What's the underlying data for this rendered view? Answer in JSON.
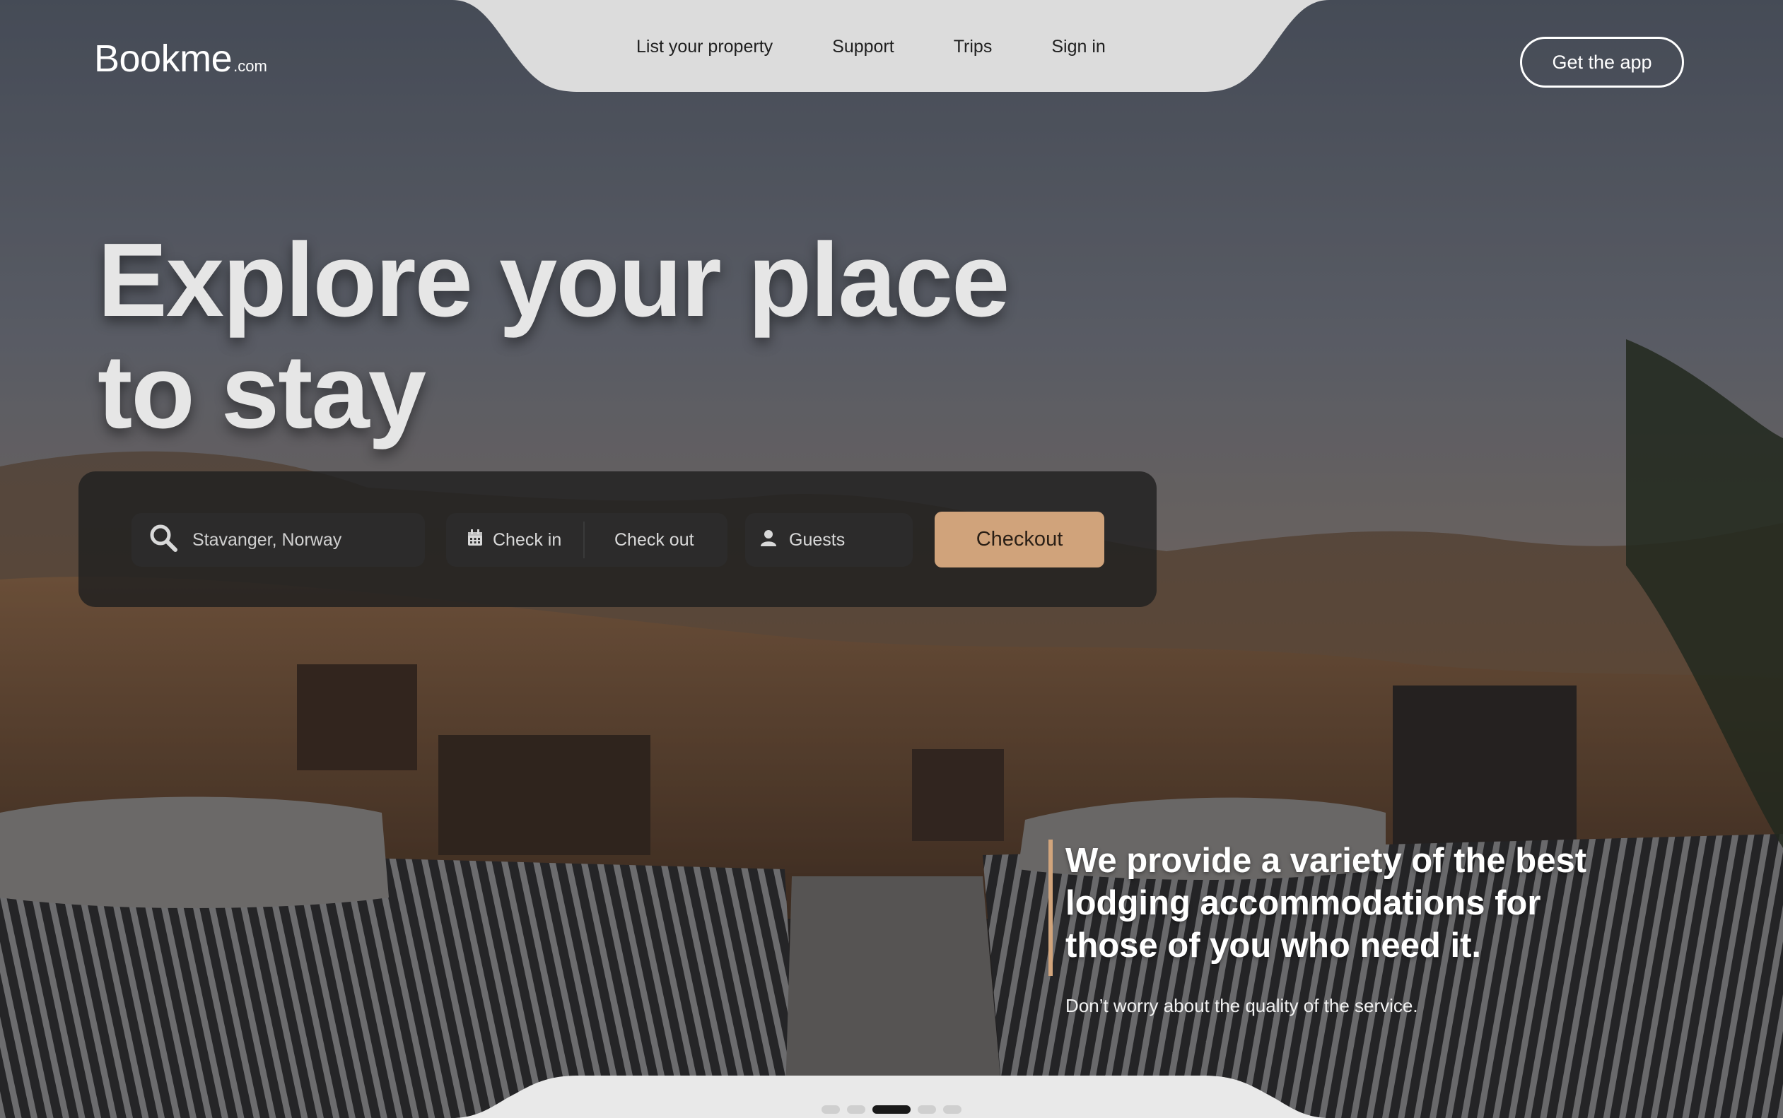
{
  "brand": {
    "name": "Bookme",
    "tld": ".com"
  },
  "nav": {
    "links": [
      "List your property",
      "Support",
      "Trips",
      "Sign in"
    ],
    "cta_label": "Get the app"
  },
  "hero": {
    "headline_line1": "Explore your place",
    "headline_line2": "to stay"
  },
  "search": {
    "location_value": "Stavanger, Norway",
    "checkin_label": "Check in",
    "checkout_label": "Check out",
    "guests_label": "Guests",
    "submit_label": "Checkout"
  },
  "promo": {
    "title": "We provide a variety of the best lodging accommodations for those of you who need it.",
    "subtitle": "Don’t worry about the quality of the service."
  },
  "pagination": {
    "total": 5,
    "active_index": 2
  },
  "colors": {
    "accent": "#d0a37b",
    "nav_bg": "#dcdcdc",
    "panel_bg": "#202020"
  },
  "icons": {
    "location": "search-icon",
    "dates": "calendar-icon",
    "guests": "user-icon"
  }
}
